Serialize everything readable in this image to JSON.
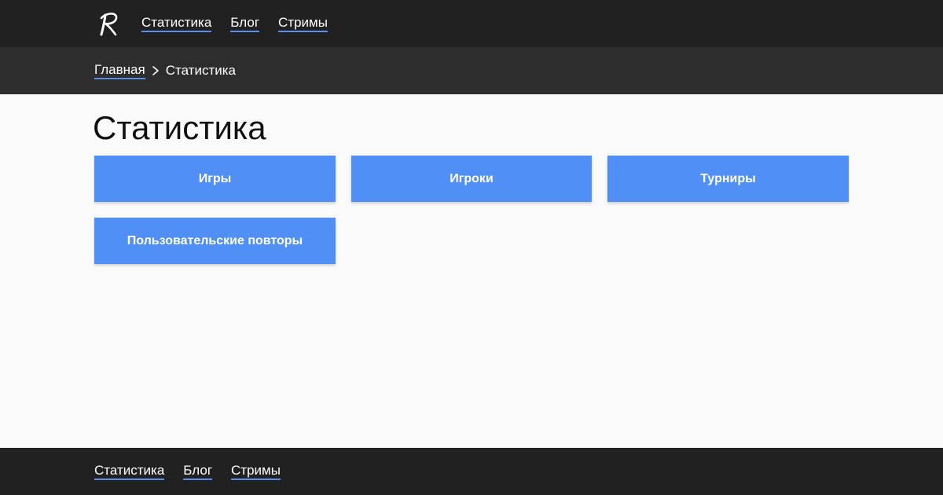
{
  "header": {
    "logo_icon": "script-r-logo-icon",
    "nav": [
      {
        "label": "Статистика"
      },
      {
        "label": "Блог"
      },
      {
        "label": "Стримы"
      }
    ]
  },
  "breadcrumb": {
    "home_label": "Главная",
    "separator_icon": "chevron-right-icon",
    "current_label": "Статистика"
  },
  "main": {
    "title": "Статистика",
    "tiles": [
      {
        "label": "Игры"
      },
      {
        "label": "Игроки"
      },
      {
        "label": "Турниры"
      },
      {
        "label": "Пользовательские повторы"
      }
    ]
  },
  "footer": {
    "nav": [
      {
        "label": "Статистика"
      },
      {
        "label": "Блог"
      },
      {
        "label": "Стримы"
      }
    ]
  },
  "colors": {
    "topbar": "#212121",
    "crumbbar": "#2d2d2d",
    "background": "#fafafa",
    "accent": "#5090f6",
    "link_underline": "#5b8def"
  }
}
